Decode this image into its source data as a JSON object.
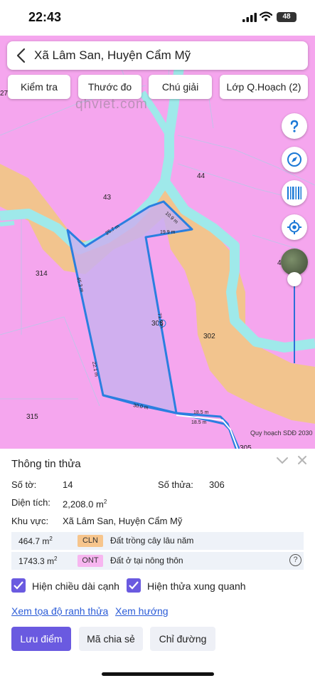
{
  "status": {
    "time": "22:43",
    "battery": "48"
  },
  "search": {
    "title": "Xã Lâm San, Huyện Cẩm Mỹ"
  },
  "toolbar": {
    "check": "Kiểm tra",
    "measure": "Thước đo",
    "legend": "Chú giải",
    "layer": "Lớp Q.Hoạch (2)"
  },
  "map": {
    "watermark": "qhviet.com",
    "credit": "Quy hoạch SDĐ 2030",
    "parcels": {
      "p27": "27",
      "p44": "44",
      "p43": "43",
      "p314": "314",
      "p306": "306",
      "p302": "302",
      "p315": "315",
      "p4": "4",
      "p305": "305"
    },
    "edges": {
      "e1": "10.9 m",
      "e2": "25.7 m",
      "e3": "19.9 m",
      "e4": "45.3 m",
      "e5": "71.0 m",
      "e6": "22.1 m",
      "e7": "30.0 m",
      "e8": "18.5 m",
      "e9": "18.5 m"
    },
    "colors": {
      "residential": "#f5a6ee",
      "perennial": "#f2c48e",
      "river": "#9fe9ea",
      "boundary": "#2a7fe0"
    }
  },
  "panel": {
    "title": "Thông tin thửa",
    "sheet_label": "Số tờ:",
    "sheet_value": "14",
    "parcel_label": "Số thửa:",
    "parcel_value": "306",
    "area_label": "Diện tích:",
    "area_value": "2,208.0 m",
    "area_unit_sup": "2",
    "region_label": "Khu vực:",
    "region_value": "Xã Lâm San, Huyện Cẩm Mỹ",
    "zones": [
      {
        "area": "464.7 m",
        "sup": "2",
        "code": "CLN",
        "desc": "Đất trồng cây lâu năm",
        "color": "#f7c58c"
      },
      {
        "area": "1743.3 m",
        "sup": "2",
        "code": "ONT",
        "desc": "Đất ở tại nông thôn",
        "color": "#f7b6f0"
      }
    ],
    "help_mark": "?",
    "opt_edges": "Hiện chiều dài cạnh",
    "opt_neighbors": "Hiện thửa xung quanh",
    "link_coords": "Xem tọa độ ranh thửa",
    "link_direction": "Xem hướng",
    "btn_save": "Lưu điểm",
    "btn_share": "Mã chia sẻ",
    "btn_route": "Chỉ đường"
  }
}
